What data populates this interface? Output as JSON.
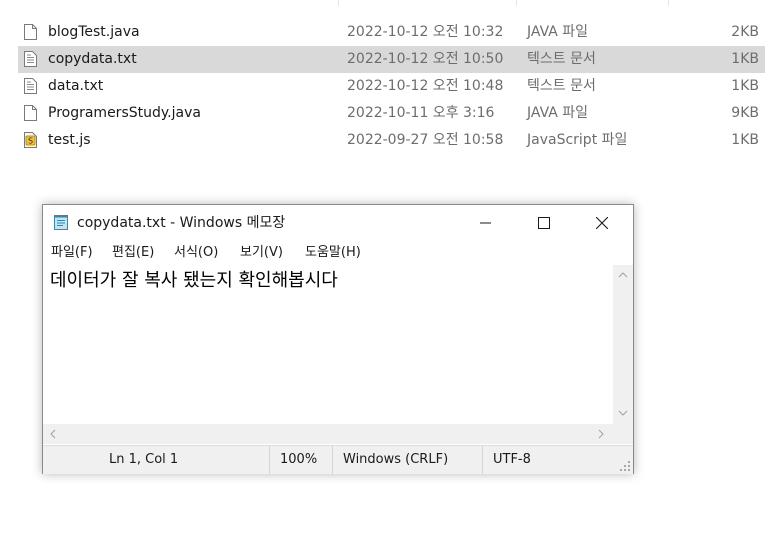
{
  "explorer": {
    "files": [
      {
        "name": "blogTest.java",
        "modified": "2022-10-12 오전 10:32",
        "type": "JAVA 파일",
        "size": "2KB",
        "icon": "blank-file-icon",
        "selected": false
      },
      {
        "name": "copydata.txt",
        "modified": "2022-10-12 오전 10:50",
        "type": "텍스트 문서",
        "size": "1KB",
        "icon": "text-file-icon",
        "selected": true
      },
      {
        "name": "data.txt",
        "modified": "2022-10-12 오전 10:48",
        "type": "텍스트 문서",
        "size": "1KB",
        "icon": "text-file-icon",
        "selected": false
      },
      {
        "name": "ProgramersStudy.java",
        "modified": "2022-10-11 오후 3:16",
        "type": "JAVA 파일",
        "size": "9KB",
        "icon": "blank-file-icon",
        "selected": false
      },
      {
        "name": "test.js",
        "modified": "2022-09-27 오전 10:58",
        "type": "JavaScript 파일",
        "size": "1KB",
        "icon": "script-file-icon",
        "selected": false
      }
    ]
  },
  "notepad": {
    "title": "copydata.txt - Windows 메모장",
    "menu": [
      "파일(F)",
      "편집(E)",
      "서식(O)",
      "보기(V)",
      "도움말(H)"
    ],
    "content": "데이터가 잘 복사 됐는지 확인해봅시다",
    "status": {
      "position": "Ln 1, Col 1",
      "zoom": "100%",
      "line_ending": "Windows (CRLF)",
      "encoding": "UTF-8"
    }
  },
  "colors": {
    "selected_row": "#d9d9d9",
    "secondary_text": "#6d6d6d",
    "chrome_gray": "#f0f0f0"
  }
}
